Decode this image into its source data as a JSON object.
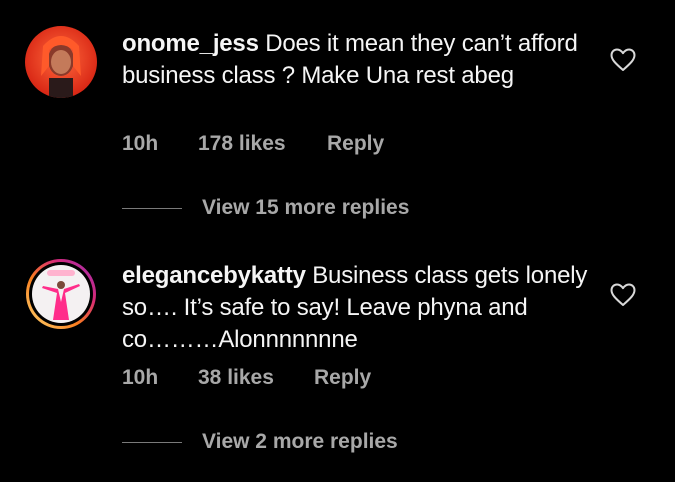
{
  "comments": [
    {
      "username": "onome_jess",
      "text": "Does it mean they can’t afford business class ? Make Una rest abeg",
      "time": "10h",
      "likes": "178 likes",
      "reply_label": "Reply",
      "view_replies": "View 15 more replies"
    },
    {
      "username": "elegancebykatty",
      "text": "Business class gets lonely so…. It’s safe to say! Leave phyna and co………Alonnnnnnne",
      "time": "10h",
      "likes": "38 likes",
      "reply_label": "Reply",
      "view_replies": "View 2 more replies"
    }
  ],
  "colors": {
    "background": "#000000",
    "text": "#f5f5f5",
    "muted": "#a8a8a8",
    "story_ring": "#e1306c"
  },
  "icons": {
    "like": "heart-outline-icon"
  }
}
